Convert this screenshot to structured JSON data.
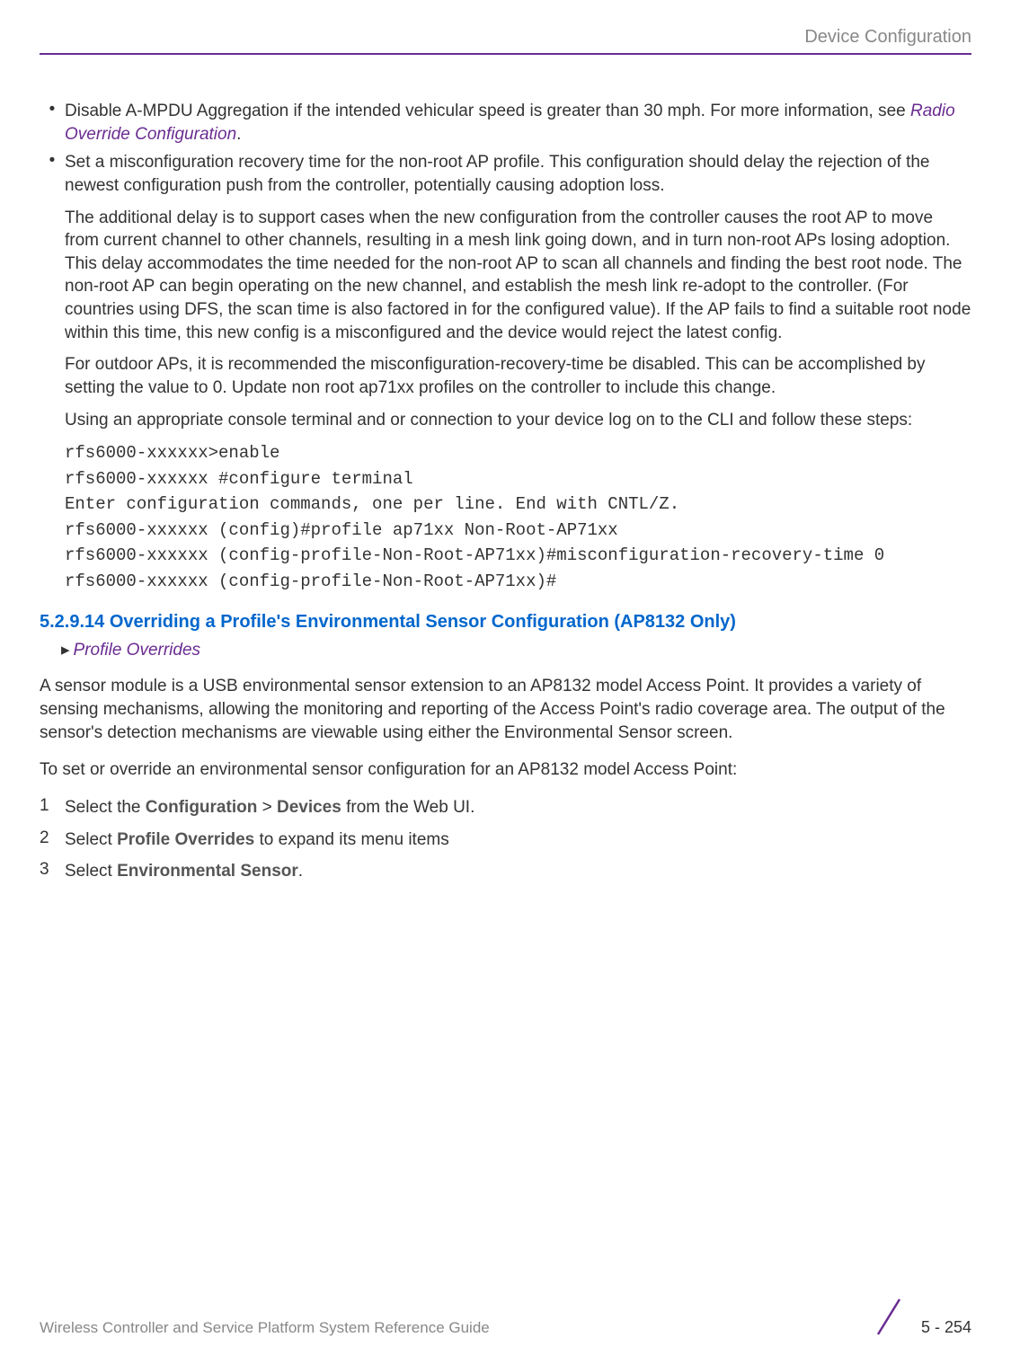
{
  "header": {
    "breadcrumb": "Device Configuration"
  },
  "bullets": [
    {
      "text_before_link": "Disable A-MPDU Aggregation if the intended vehicular speed is greater than 30 mph. For more information, see ",
      "link": "Radio Override Configuration",
      "text_after_link": "."
    },
    {
      "text": "Set a misconfiguration recovery time for the non-root AP profile. This configuration should delay the rejection of the newest configuration push from the controller, potentially causing adoption loss."
    }
  ],
  "sub_paragraphs": [
    "The additional delay is to support cases when the new configuration from the controller causes the root AP to move from current channel to other channels, resulting in a mesh link going down, and in turn non-root APs losing adoption. This delay accommodates the time needed for the non-root AP to scan all channels and finding the best root node. The non-root AP can begin operating on the new channel, and establish the mesh link re-adopt to the controller. (For countries using DFS, the scan time is also factored in for the configured value). If the AP fails to find a suitable root node within this time, this new config is a misconfigured and the device would reject the latest config.",
    "For outdoor APs, it is recommended the misconfiguration-recovery-time be disabled. This can be accomplished by setting the value to 0. Update non root ap71xx profiles on the controller to include this change.",
    "Using an appropriate console terminal and or connection to your device log on to the CLI and follow these steps:"
  ],
  "cli_lines": [
    "rfs6000-xxxxxx>enable",
    "rfs6000-xxxxxx #configure terminal",
    "Enter configuration commands, one per line. End with CNTL/Z.",
    "rfs6000-xxxxxx (config)#profile ap71xx Non-Root-AP71xx",
    "rfs6000-xxxxxx (config-profile-Non-Root-AP71xx)#misconfiguration-recovery-time 0",
    "rfs6000-xxxxxx (config-profile-Non-Root-AP71xx)#"
  ],
  "section": {
    "heading": "5.2.9.14 Overriding a Profile's Environmental Sensor Configuration (AP8132 Only)",
    "breadcrumb": "Profile Overrides"
  },
  "body_paragraphs": [
    "A sensor module is a USB environmental sensor extension to an AP8132 model Access Point. It provides a variety of sensing mechanisms, allowing the monitoring and reporting of the Access Point's radio coverage area. The output of the sensor's detection mechanisms are viewable using either the Environmental Sensor screen.",
    "To set or override an environmental sensor configuration for an AP8132 model Access Point:"
  ],
  "steps": [
    {
      "num": "1",
      "pre": "Select the ",
      "bold1": "Configuration",
      "mid": " > ",
      "bold2": "Devices",
      "post": " from the Web UI."
    },
    {
      "num": "2",
      "pre": "Select ",
      "bold1": "Profile Overrides",
      "post": " to expand its menu items"
    },
    {
      "num": "3",
      "pre": "Select ",
      "bold1": "Environmental Sensor",
      "post": "."
    }
  ],
  "footer": {
    "guide_name": "Wireless Controller and Service Platform System Reference Guide",
    "page_number": "5 - 254"
  }
}
